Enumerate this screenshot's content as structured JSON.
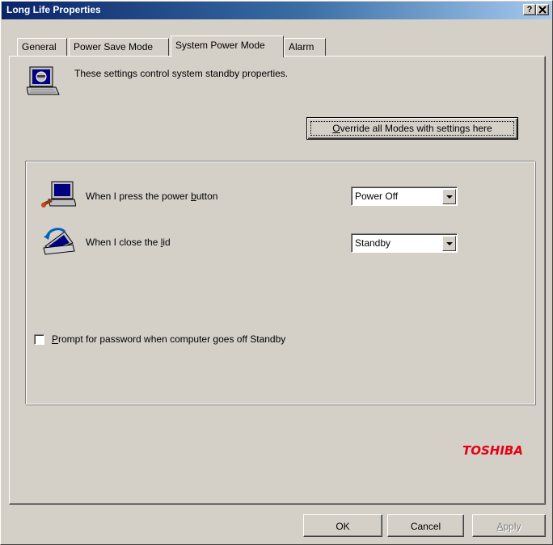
{
  "window": {
    "title": "Long Life Properties",
    "help_button": "?",
    "close_button": "✕"
  },
  "tabs": [
    {
      "label": "General",
      "active": false
    },
    {
      "label": "Power Save Mode",
      "active": false
    },
    {
      "label": "System Power Mode",
      "active": true
    },
    {
      "label": "Alarm",
      "active": false
    }
  ],
  "panel": {
    "info_icon": "laptop-settings-icon",
    "info_text": "These settings control system standby properties.",
    "override_button": {
      "pre": "",
      "mnemonic": "O",
      "post": "verride all Modes with settings here"
    },
    "power_row": {
      "icon": "laptop-power-icon",
      "label": {
        "pre": "When I press the power ",
        "mnemonic": "b",
        "post": "utton"
      },
      "value": "Power Off"
    },
    "lid_row": {
      "icon": "laptop-lid-icon",
      "label": {
        "pre": "When I close the ",
        "mnemonic": "l",
        "post": "id"
      },
      "value": "Standby"
    },
    "password_checkbox": {
      "checked": false,
      "label": {
        "pre": "",
        "mnemonic": "P",
        "post": "rompt for password when computer goes off Standby"
      }
    },
    "logo_text": "TOSHIBA"
  },
  "buttons": {
    "ok": "OK",
    "cancel": "Cancel",
    "apply": {
      "pre": "",
      "mnemonic": "A",
      "post": "pply"
    }
  },
  "colors": {
    "title_start": "#0a246a",
    "title_end": "#a6caf0",
    "logo": "#e60012",
    "face": "#d4d0c8"
  }
}
